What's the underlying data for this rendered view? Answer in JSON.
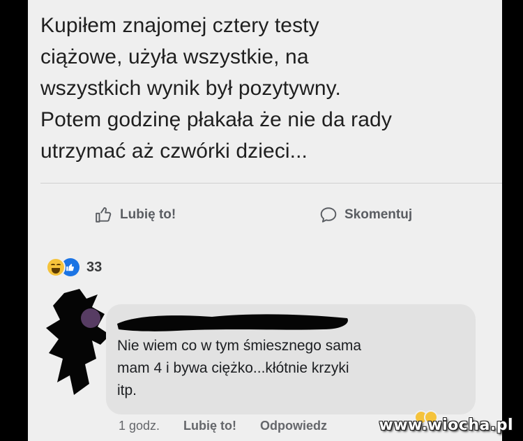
{
  "post": {
    "text": "Kupiłem znajomej cztery testy\nciążowe, użyła wszystkie, na\nwszystkich wynik był pozytywny.\nPotem godzinę płakała że nie da rady\nutrzymać aż czwórki dzieci..."
  },
  "actions": {
    "like_label": "Lubię to!",
    "comment_label": "Skomentuj"
  },
  "reactions": {
    "count": "33",
    "types": [
      "haha-icon",
      "like-icon"
    ]
  },
  "comment": {
    "text": "Nie wiem co w tym śmiesznego sama\nmam 4 i bywa ciężko...kłótnie krzyki\nitp.",
    "time": "1 godz.",
    "like_label": "Lubię to!",
    "reply_label": "Odpowiedz"
  },
  "watermark": "www.wiocha.pl",
  "colors": {
    "background": "#efefef",
    "like_blue": "#1b74e4",
    "haha_yellow": "#f5c33b",
    "bubble": "#e2e2e2"
  }
}
